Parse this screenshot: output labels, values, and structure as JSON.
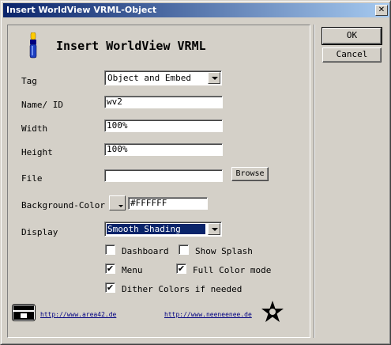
{
  "window": {
    "title": "Insert WorldView VRML-Object",
    "close_glyph": "✕"
  },
  "header": {
    "title": "Insert WorldView VRML",
    "icon": "vrml-plugin-icon"
  },
  "buttons": {
    "ok": "OK",
    "cancel": "Cancel",
    "browse": "Browse"
  },
  "form": {
    "tag": {
      "label": "Tag",
      "value": "Object and Embed"
    },
    "name_id": {
      "label": "Name/ ID",
      "value": "wv2"
    },
    "width": {
      "label": "Width",
      "value": "100%"
    },
    "height": {
      "label": "Height",
      "value": "100%"
    },
    "file": {
      "label": "File",
      "value": ""
    },
    "background_color": {
      "label": "Background-Color",
      "value": "#FFFFFF",
      "swatch": "#FFFFFF"
    },
    "display": {
      "label": "Display",
      "value": "Smooth Shading"
    }
  },
  "options": {
    "dashboard": {
      "label": "Dashboard",
      "checked": false
    },
    "show_splash": {
      "label": "Show Splash",
      "checked": false
    },
    "menu": {
      "label": "Menu",
      "checked": true
    },
    "full_color_mode": {
      "label": "Full Color mode",
      "checked": true
    },
    "dither_colors": {
      "label": "Dither Colors if needed",
      "checked": true
    }
  },
  "footer": {
    "link_left": "http://www.area42.de",
    "link_right": "http://www.neeneenee.de",
    "logo_left": "area42-logo-icon",
    "logo_right": "neeneenee-star-logo-icon"
  },
  "check_glyph": "✔"
}
